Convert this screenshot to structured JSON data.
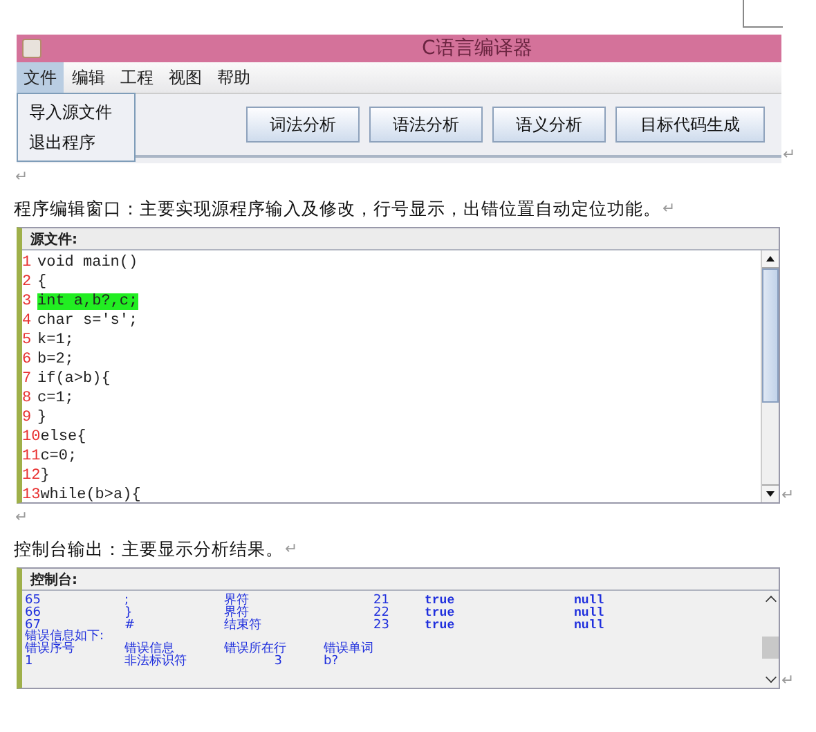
{
  "app_window": {
    "title": "C语言编译器",
    "menu": [
      {
        "label": "文件",
        "selected": true
      },
      {
        "label": "编辑",
        "selected": false
      },
      {
        "label": "工程",
        "selected": false
      },
      {
        "label": "视图",
        "selected": false
      },
      {
        "label": "帮助",
        "selected": false
      }
    ],
    "dropdown": [
      "导入源文件",
      "退出程序"
    ],
    "buttons": [
      "词法分析",
      "语法分析",
      "语义分析",
      "目标代码生成"
    ],
    "end_mark": "↵"
  },
  "empty_paragraph": {
    "end_mark": "↵"
  },
  "caption_1": {
    "text": "程序编辑窗口：主要实现源程序输入及修改，行号显示，出错位置自动定位功能。",
    "end_mark": "↵"
  },
  "source_panel": {
    "title": "源文件:",
    "end_mark": "↵",
    "lines": [
      {
        "number": "1",
        "code": "void main()",
        "highlighted": false
      },
      {
        "number": "2",
        "code": "{",
        "highlighted": false
      },
      {
        "number": "3",
        "code": "int a,b?,c;",
        "highlighted": true
      },
      {
        "number": "4",
        "code": "char s='s';",
        "highlighted": false
      },
      {
        "number": "5",
        "code": "k=1;",
        "highlighted": false
      },
      {
        "number": "6",
        "code": "b=2;",
        "highlighted": false
      },
      {
        "number": "7",
        "code": "if(a>b){",
        "highlighted": false
      },
      {
        "number": "8",
        "code": "c=1;",
        "highlighted": false
      },
      {
        "number": "9",
        "code": "}",
        "highlighted": false
      },
      {
        "number": "10",
        "code": "else{",
        "highlighted": false
      },
      {
        "number": "11",
        "code": "c=0;",
        "highlighted": false
      },
      {
        "number": "12",
        "code": "}",
        "highlighted": false
      },
      {
        "number": "13",
        "code": "while(b>a){",
        "highlighted": false
      }
    ]
  },
  "empty_paragraph_2": {
    "end_mark": "↵"
  },
  "caption_2": {
    "text": "控制台输出：主要显示分析结果。",
    "end_mark": "↵"
  },
  "console_panel": {
    "title": "控制台:",
    "end_mark": "↵",
    "token_rows": [
      [
        "65",
        ";",
        "界符",
        "21",
        "true",
        "null"
      ],
      [
        "66",
        "}",
        "界符",
        "22",
        "true",
        "null"
      ],
      [
        "67",
        "#",
        "结束符",
        "23",
        "true",
        "null"
      ]
    ],
    "error_heading": "错误信息如下:",
    "error_columns": [
      "错误序号",
      "错误信息",
      "错误所在行",
      "错误单词"
    ],
    "error_rows": [
      [
        "1",
        "非法标识符",
        "3",
        "b?"
      ]
    ]
  }
}
